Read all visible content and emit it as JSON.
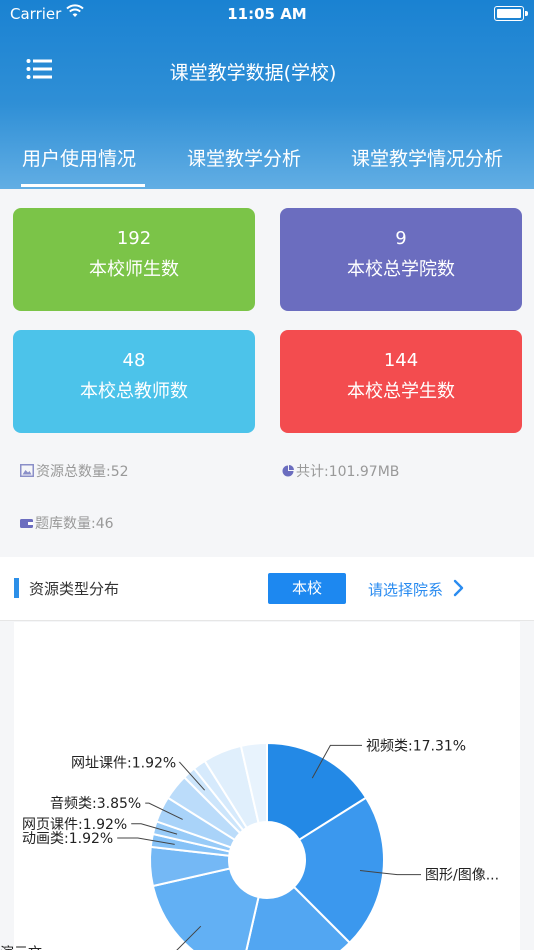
{
  "status": {
    "carrier": "Carrier",
    "time": "11:05 AM"
  },
  "header": {
    "title": "课堂教学数据(学校)"
  },
  "tabs": [
    {
      "label": "用户使用情况"
    },
    {
      "label": "课堂教学分析"
    },
    {
      "label": "课堂教学情况分析"
    }
  ],
  "cards": [
    {
      "value": "192",
      "label": "本校师生数",
      "color": "#7bc448"
    },
    {
      "value": "9",
      "label": "本校总学院数",
      "color": "#6b6dbf"
    },
    {
      "value": "48",
      "label": "本校总教师数",
      "color": "#4cc3ea"
    },
    {
      "value": "144",
      "label": "本校总学生数",
      "color": "#f34c4f"
    }
  ],
  "info": {
    "resources": "资源总数量:52",
    "total_size": "共计:101.97MB",
    "question_bank": "题库数量:46"
  },
  "section": {
    "title": "资源类型分布",
    "school_button": "本校",
    "dept_select": "请选择院系"
  },
  "chart_data": {
    "type": "pie",
    "slices": [
      {
        "label": "视频类:17.31%",
        "value": 17.31,
        "color": "#2389e6"
      },
      {
        "label": "图形/图像...",
        "value": 23.08,
        "color": "#3b98ee"
      },
      {
        "label": "",
        "value": 17.31,
        "color": "#52a6f2"
      },
      {
        "label": "演示文...",
        "value": 19.23,
        "color": "#62b0f4"
      },
      {
        "label": "",
        "value": 5.77,
        "color": "#74b8f5"
      },
      {
        "label": "动画类:1.92%",
        "value": 1.92,
        "color": "#86c2f7"
      },
      {
        "label": "网页课件:1.92%",
        "value": 1.92,
        "color": "#98cbf8"
      },
      {
        "label": "音频类:3.85%",
        "value": 3.85,
        "color": "#a9d3f9"
      },
      {
        "label": "",
        "value": 3.85,
        "color": "#bbdcfa"
      },
      {
        "label": "网址课件:1.92%",
        "value": 1.92,
        "color": "#cce5fb"
      },
      {
        "label": "",
        "value": 1.92,
        "color": "#d6eafc"
      },
      {
        "label": "",
        "value": 5.77,
        "color": "#e0effc"
      },
      {
        "label": "",
        "value": 3.85,
        "color": "#e8f3fd"
      }
    ]
  }
}
